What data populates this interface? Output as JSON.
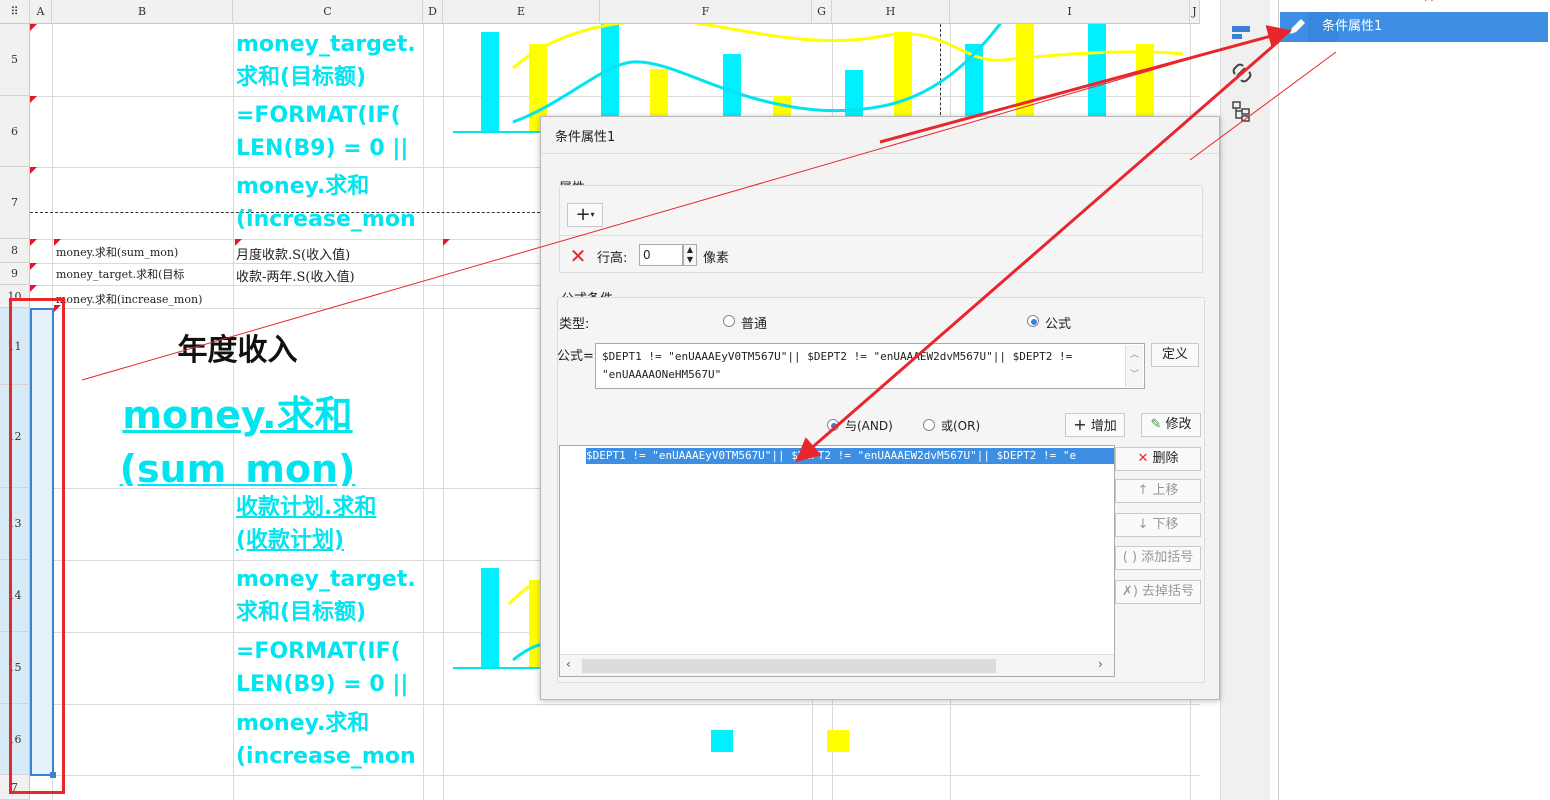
{
  "columns": [
    "A",
    "B",
    "C",
    "D",
    "E",
    "F",
    "G",
    "H",
    "I",
    "J"
  ],
  "rows": {
    "r5": "5",
    "r6": "6",
    "r7": "7",
    "r8": "8",
    "r9": "9",
    "r10": "10",
    "r11": "11",
    "r12": "12",
    "r13": "13",
    "r14": "14",
    "r15": "15",
    "r16": "16",
    "r17": "7"
  },
  "cells": {
    "c5": "money_target.\n求和(目标额)",
    "c6": "=FORMAT(IF(\nLEN(B9) = 0 ||",
    "c7": "money.求和\n(increase_mon",
    "b8": "money.求和(sum_mon)",
    "c8": "月度收款.S(收入值)",
    "b9": "money_target.求和(目标",
    "c9": "收款-两年.S(收入值)",
    "b10": "money.求和(increase_mon)",
    "title": "年度收入",
    "big": "money.求和\n(sum_mon)",
    "c13": "收款计划.求和\n(收款计划)",
    "c14": "money_target.\n求和(目标额)",
    "c15": "=FORMAT(IF(\nLEN(B9) = 0 ||",
    "c16": "money.求和\n(increase_mon"
  },
  "chart": {
    "chart_data": {
      "type": "bar",
      "series": [
        {
          "name": "",
          "color": "#00f0ff"
        },
        {
          "name": "",
          "color": "#ffff00"
        }
      ],
      "legend_position": "bottom"
    },
    "colors": {
      "cyan": "#00f0ff",
      "yellow": "#ffff00"
    }
  },
  "dialog": {
    "title": "条件属性1",
    "attr_section": "属性:",
    "add_symbol": "+",
    "row_height_label": "行高:",
    "row_height_value": "0",
    "unit": "像素",
    "formula_section": "公式条件",
    "type_label": "类型:",
    "opt_normal": "普通",
    "opt_formula": "公式",
    "formula_label": "公式=",
    "formula_line1": "$DEPT1 != \"enUAAAEyV0TM567U\"|| $DEPT2 != \"enUAAAEW2dvM567U\"|| $DEPT2 !=",
    "formula_line2": "\"enUAAAAONeHM567U\"",
    "define_btn": "定义",
    "and_label": "与(AND)",
    "or_label": "或(OR)",
    "add_btn": "增加",
    "modify_btn": "修改",
    "delete_btn": "删除",
    "up_btn": "上移",
    "down_btn": "下移",
    "add_bracket_btn": "添加括号",
    "remove_bracket_btn": "去掉括号",
    "list_item": "$DEPT1 != \"enUAAAEyV0TM567U\"|| $DEPT2 != \"enUAAAEW2dvM567U\"|| $DEPT2 != \"e"
  },
  "panel": {
    "item_label": "条件属性1"
  },
  "icons": [
    "pencil-icon",
    "close-x-icon",
    "link-icon",
    "tree-icon",
    "condition-icon",
    "plus-icon",
    "up-arrow-icon",
    "down-arrow-icon",
    "bracket-icon"
  ]
}
